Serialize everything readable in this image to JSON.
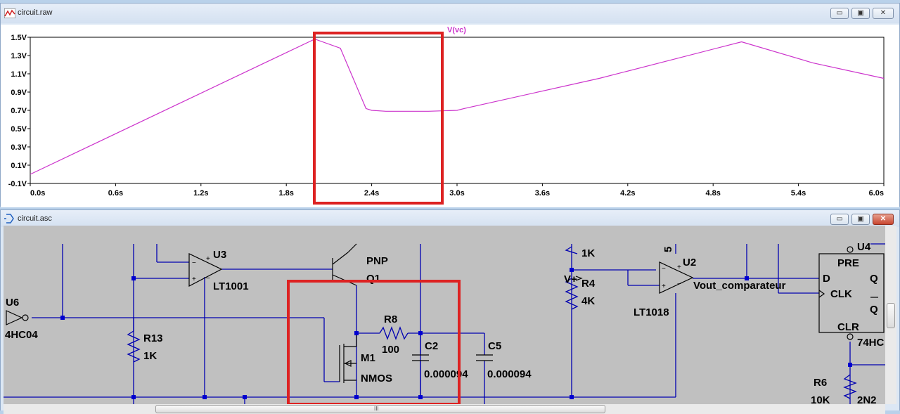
{
  "plot_window": {
    "title": "circuit.raw",
    "trace_label": "V(vc)",
    "y_ticks": [
      "1.5V",
      "1.3V",
      "1.1V",
      "0.9V",
      "0.7V",
      "0.5V",
      "0.3V",
      "0.1V",
      "-0.1V"
    ],
    "x_ticks": [
      "0.0s",
      "0.6s",
      "1.2s",
      "1.8s",
      "2.4s",
      "3.0s",
      "3.6s",
      "4.2s",
      "4.8s",
      "5.4s",
      "6.0s"
    ],
    "trace_color": "#cc33cc",
    "highlight_color": "#dd2222"
  },
  "chart_data": {
    "type": "line",
    "title": "",
    "xlabel": "",
    "ylabel": "",
    "xlim": [
      0,
      6.0
    ],
    "ylim": [
      -0.1,
      1.5
    ],
    "series": [
      {
        "name": "V(vc)",
        "x": [
          0,
          2.0,
          2.18,
          2.36,
          2.4,
          2.5,
          2.8,
          3.0,
          3.05,
          4.0,
          5.0,
          5.5,
          6.0
        ],
        "y": [
          0.0,
          1.48,
          1.38,
          0.72,
          0.7,
          0.69,
          0.69,
          0.7,
          0.72,
          1.05,
          1.45,
          1.22,
          1.05
        ]
      }
    ]
  },
  "schematic_window": {
    "title": "circuit.asc",
    "labels": {
      "u3": "U3",
      "lt1001": "LT1001",
      "pnp": "PNP",
      "q1": "Q1",
      "u6": "U6",
      "hc04": "4HC04",
      "r13": "R13",
      "r13_val": "1K",
      "r8": "R8",
      "r8_val": "100",
      "c2": "C2",
      "c2_val": "0.000094",
      "c5": "C5",
      "c5_val": "0.000094",
      "m1": "M1",
      "nmos": "NMOS",
      "r_top_val": "1K",
      "v_plus": "V+",
      "r4": "R4",
      "r4_val": "4K",
      "five": "5",
      "u2": "U2",
      "lt1018": "LT1018",
      "vout": "Vout_comparateur",
      "u4": "U4",
      "pre": "PRE",
      "d": "D",
      "q": "Q",
      "clk": "CLK",
      "qbar": "Q",
      "clr": "CLR",
      "ff": "74HC",
      "r6": "R6",
      "r6_val": "10K",
      "bottom_part": "2N2"
    },
    "scroll_glyph": "III"
  },
  "window_controls": {
    "minimize": "▭",
    "maximize": "▣",
    "close": "✕"
  }
}
